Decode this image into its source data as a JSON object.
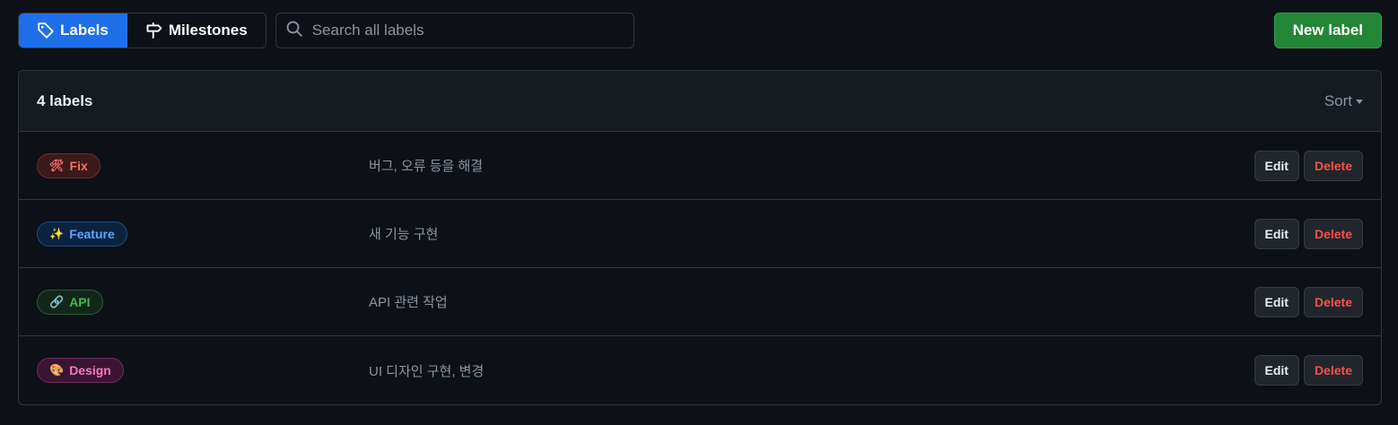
{
  "nav": {
    "labels_tab": "Labels",
    "milestones_tab": "Milestones"
  },
  "search": {
    "placeholder": "Search all labels",
    "value": ""
  },
  "new_label_button": "New label",
  "list": {
    "count_text": "4 labels",
    "sort_label": "Sort",
    "rows": [
      {
        "emoji": "🛠",
        "name": "Fix",
        "description": "버그, 오류 등을 해결",
        "edit": "Edit",
        "delete": "Delete",
        "color": "#f47067",
        "bg": "#3b1a1c",
        "border": "#6e2b2f"
      },
      {
        "emoji": "✨",
        "name": "Feature",
        "description": "새 기능 구현",
        "edit": "Edit",
        "delete": "Delete",
        "color": "#58a6ff",
        "bg": "#0c2340",
        "border": "#1f4a80"
      },
      {
        "emoji": "🔗",
        "name": "API",
        "description": "API 관련 작업",
        "edit": "Edit",
        "delete": "Delete",
        "color": "#3fb950",
        "bg": "#12261a",
        "border": "#2b5a33"
      },
      {
        "emoji": "🎨",
        "name": "Design",
        "description": "UI 디자인 구현, 변경",
        "edit": "Edit",
        "delete": "Delete",
        "color": "#f778ba",
        "bg": "#3a1533",
        "border": "#6e2b5d"
      }
    ]
  },
  "colors": {
    "accent": "#1f6feb",
    "primary_button": "#238636",
    "danger": "#f85149",
    "background": "#0d1117"
  }
}
